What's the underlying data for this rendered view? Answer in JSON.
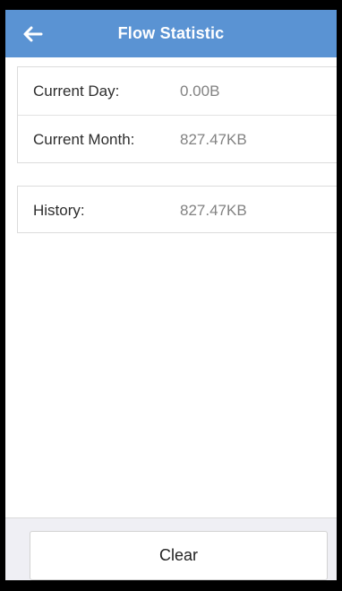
{
  "header": {
    "title": "Flow Statistic",
    "back_icon": "arrow-left-icon"
  },
  "stats": {
    "current_day": {
      "label": "Current Day:",
      "value": "0.00B"
    },
    "current_month": {
      "label": "Current Month:",
      "value": "827.47KB"
    },
    "history": {
      "label": "History:",
      "value": "827.47KB"
    }
  },
  "footer": {
    "clear_label": "Clear"
  },
  "colors": {
    "header_background": "#5a93d3",
    "value_text": "#828282",
    "footer_background": "#efeff4"
  }
}
